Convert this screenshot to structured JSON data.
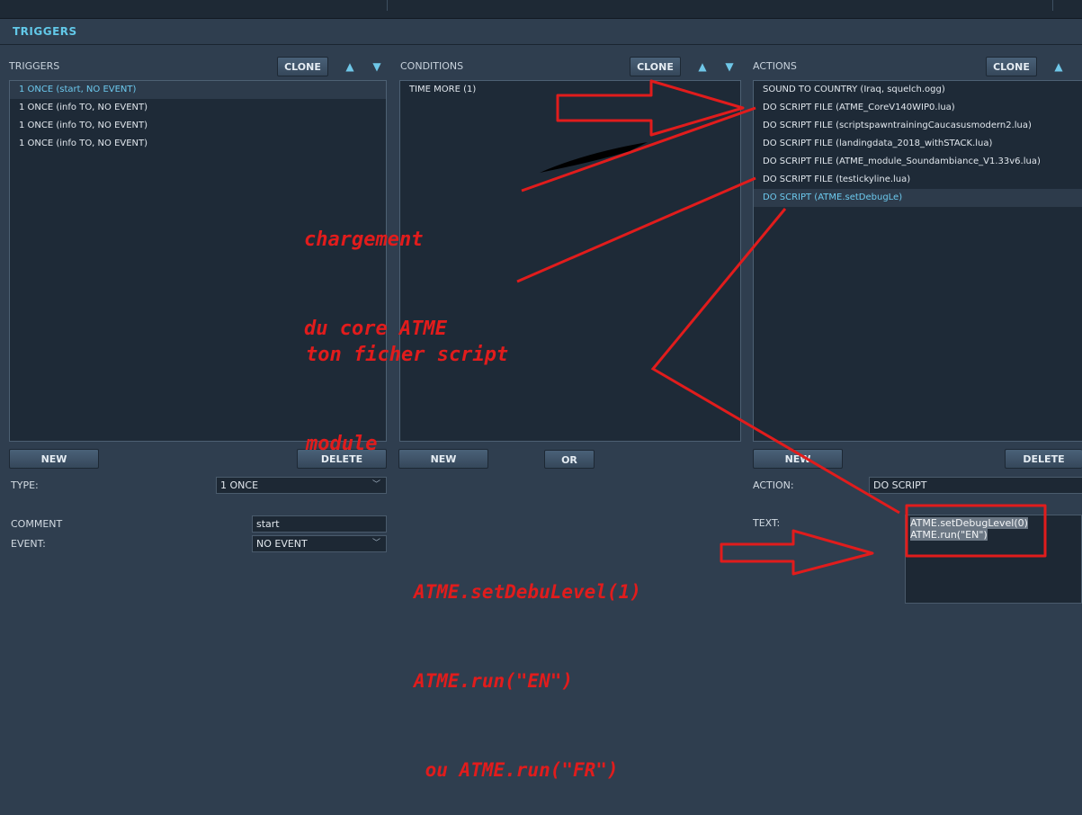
{
  "header": {
    "title": "TRIGGERS"
  },
  "triggers": {
    "label": "TRIGGERS",
    "clone": "CLONE",
    "items": [
      "1 ONCE (start, NO EVENT)",
      "1 ONCE (info TO, NO EVENT)",
      "1 ONCE (info TO, NO EVENT)",
      "1 ONCE (info TO, NO EVENT)"
    ],
    "selected_index": 0,
    "new": "NEW",
    "delete": "DELETE"
  },
  "conditions": {
    "label": "CONDITIONS",
    "clone": "CLONE",
    "items": [
      "TIME MORE (1)"
    ],
    "new": "NEW",
    "or": "OR"
  },
  "actions": {
    "label": "ACTIONS",
    "clone": "CLONE",
    "items": [
      "SOUND TO COUNTRY (Iraq, squelch.ogg)",
      "DO SCRIPT FILE (ATME_CoreV140WIP0.lua)",
      "DO SCRIPT FILE (scriptspawntrainingCaucasusmodern2.lua)",
      "DO SCRIPT FILE (landingdata_2018_withSTACK.lua)",
      "DO SCRIPT FILE (ATME_module_Soundambiance_V1.33v6.lua)",
      "DO SCRIPT FILE (testickyline.lua)",
      "DO SCRIPT (ATME.setDebugLe)"
    ],
    "selected_index": 6,
    "new": "NEW",
    "delete": "DELETE"
  },
  "form": {
    "type_label": "TYPE:",
    "type_value": "1 ONCE",
    "comment_label": "COMMENT",
    "comment_value": "start",
    "event_label": "EVENT:",
    "event_value": "NO EVENT",
    "action_label": "ACTION:",
    "action_value": "DO SCRIPT",
    "text_label": "TEXT:",
    "text_lines": [
      "ATME.setDebugLevel(0)",
      "ATME.run(\"EN\")"
    ]
  },
  "annotations": {
    "core_1": "chargement",
    "core_2": "du core ATME",
    "module_1": "ton ficher script",
    "module_2": "module",
    "code_1": "ATME.setDebuLevel(1)",
    "code_2": "ATME.run(\"EN\")",
    "code_3": " ou ATME.run(\"FR\")",
    "color": "#e11c1c"
  },
  "icons": {
    "up": "chevron-up-icon",
    "down": "chevron-down-icon",
    "dropdown": "chevron-down-icon"
  },
  "colors": {
    "accent": "#62c8e8",
    "background": "#2f3e4f",
    "panel": "#1e2a37"
  }
}
